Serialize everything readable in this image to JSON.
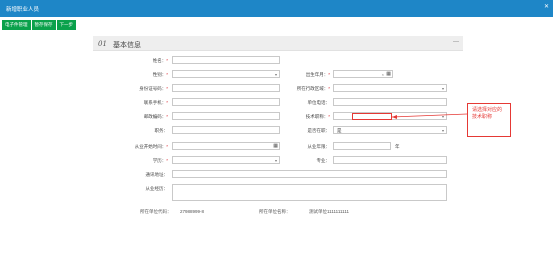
{
  "window": {
    "title": "新增职业人员",
    "close_glyph": "✕"
  },
  "toolbar": {
    "buttons": [
      "电子件管理",
      "暂存保存",
      "下一步"
    ]
  },
  "section": {
    "number": "01",
    "title": "基本信息",
    "more": "—"
  },
  "required_mark": "*",
  "labels": {
    "name": "姓名：",
    "gender": "性别：",
    "birth": "出生年月：",
    "id_type": "身份证号码：",
    "region": "所在行政区域：",
    "mobile": "联系手机：",
    "unit_phone": "单位电话：",
    "postcode": "邮政编码：",
    "tech_title": "技术职称：",
    "position": "职务：",
    "is_leader": "是否在职：",
    "start_date": "从业开始时间：",
    "years": "从业年限：",
    "education": "学历：",
    "major": "专业：",
    "address": "通讯地址：",
    "experience": "从业经历：",
    "unit_code": "所在单位代码：",
    "unit_name": "所在单位名称："
  },
  "values": {
    "is_leader": "是",
    "years_suffix": "年",
    "unit_code": "27988999-8",
    "unit_name": "测试单位1111111111"
  },
  "icons": {
    "caret": "▾",
    "calendar": "▦"
  },
  "callout": {
    "text": "请选择对应的技术职称"
  },
  "colors": {
    "titlebar": "#1e86c7",
    "toolbar_button": "#0aa14b",
    "highlight": "#e53935"
  }
}
